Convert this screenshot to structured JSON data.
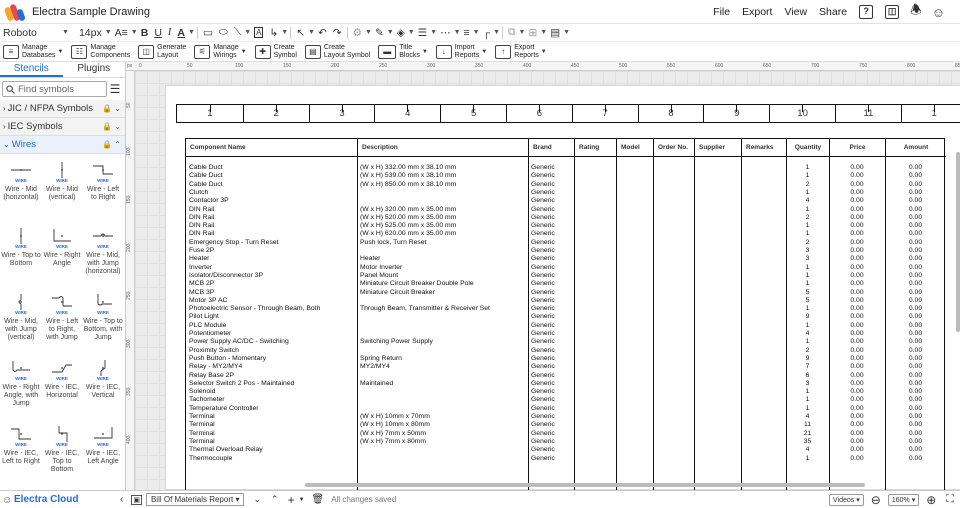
{
  "app": {
    "title": "Electra Sample Drawing"
  },
  "menu": [
    "File",
    "Export",
    "View",
    "Share"
  ],
  "menu_icons": [
    "help-icon",
    "layout-icon",
    "bell-icon",
    "user-icon"
  ],
  "format_toolbar": {
    "font": "Roboto",
    "size": "14px",
    "text_size_label": "A≡",
    "bold": "B",
    "underline": "U",
    "italic": "I",
    "font_color": "A"
  },
  "toolbar": [
    {
      "icon": "database-icon",
      "label1": "Manage",
      "label2": "Databases"
    },
    {
      "icon": "components-icon",
      "label1": "Manage",
      "label2": "Components"
    },
    {
      "icon": "generate-layout-icon",
      "label1": "Generate",
      "label2": "Layout"
    },
    {
      "icon": "wirings-icon",
      "label1": "Manage",
      "label2": "Wirings"
    },
    {
      "icon": "create-symbol-icon",
      "label1": "Create",
      "label2": "Symbol"
    },
    {
      "icon": "layout-symbol-icon",
      "label1": "Create",
      "label2": "Layout Symbol"
    },
    {
      "icon": "title-blocks-icon",
      "label1": "Title",
      "label2": "Blocks"
    },
    {
      "icon": "import-icon",
      "label1": "Import",
      "label2": "Reports"
    },
    {
      "icon": "export-icon",
      "label1": "Export",
      "label2": "Reports"
    }
  ],
  "sidebar": {
    "tabs": [
      "Stencils",
      "Plugins"
    ],
    "search_placeholder": "Find symbols",
    "categories": [
      "JIC / NFPA Symbols",
      "IEC Symbols",
      "Wires"
    ],
    "wire_label": "WIRE",
    "stencils": [
      "Wire - Mid (horizontal)",
      "Wire - Mid (vertical)",
      "Wire - Left to Right",
      "Wire - Top to Bottom",
      "Wire - Right Angle",
      "Wire - Mid, with Jump (horizontal)",
      "Wire - Mid, with Jump (vertical)",
      "Wire - Left to Right, with Jump",
      "Wire - Top to Bottom, with Jump",
      "Wire - Right Angle, with Jump",
      "Wire - IEC, Horizontal",
      "Wire - IEC, Vertical",
      "Wire - IEC, Left to Right",
      "Wire - IEC, Top to Bottom",
      "Wire - IEC, Left Angle"
    ]
  },
  "rulers": {
    "top": [
      "px",
      "0",
      "50",
      "100",
      "150",
      "200",
      "250",
      "300",
      "350",
      "400",
      "450",
      "500",
      "550",
      "600",
      "650",
      "700",
      "750",
      "800",
      "850"
    ],
    "left": [
      "50",
      "100",
      "150",
      "200",
      "250",
      "300",
      "350",
      "400"
    ]
  },
  "zones": [
    "1",
    "2",
    "3",
    "4",
    "5",
    "6",
    "7",
    "8",
    "9",
    "10",
    "11",
    "1"
  ],
  "bom": {
    "headers": [
      "Component Name",
      "Description",
      "Brand",
      "Rating",
      "Model",
      "Order No.",
      "Supplier",
      "Remarks",
      "Quantity",
      "Price",
      "Amount"
    ],
    "rows": [
      [
        "Cable Duct",
        "(W x H) 332.00 mm x 38.10 mm",
        "Generic",
        "1",
        "0.00",
        "0.00"
      ],
      [
        "Cable Duct",
        "(W x H) 539.00 mm x 38.10 mm",
        "Generic",
        "1",
        "0.00",
        "0.00"
      ],
      [
        "Cable Duct",
        "(W x H) 850.00 mm x 38.10 mm",
        "Generic",
        "2",
        "0.00",
        "0.00"
      ],
      [
        "Clutch",
        "",
        "Generic",
        "1",
        "0.00",
        "0.00"
      ],
      [
        "Contactor 3P",
        "",
        "Generic",
        "4",
        "0.00",
        "0.00"
      ],
      [
        "DIN Rail",
        "(W x H) 320.00 mm x 35.00 mm",
        "Generic",
        "1",
        "0.00",
        "0.00"
      ],
      [
        "DIN Rail",
        "(W x H) 520.00 mm x 35.00 mm",
        "Generic",
        "2",
        "0.00",
        "0.00"
      ],
      [
        "DIN Rail",
        "(W x H) 525.00 mm x 35.00 mm",
        "Generic",
        "1",
        "0.00",
        "0.00"
      ],
      [
        "DIN Rail",
        "(W x H) 620.00 mm x 35.00 mm",
        "Generic",
        "1",
        "0.00",
        "0.00"
      ],
      [
        "Emergency Stop - Turn Reset",
        "Push lock, Turn Reset",
        "Generic",
        "2",
        "0.00",
        "0.00"
      ],
      [
        "Fuse 2P",
        "",
        "Generic",
        "3",
        "0.00",
        "0.00"
      ],
      [
        "Heater",
        "Heater",
        "Generic",
        "3",
        "0.00",
        "0.00"
      ],
      [
        "Inverter",
        "Motor Inverter",
        "Generic",
        "1",
        "0.00",
        "0.00"
      ],
      [
        "Isolator/Disconnector 3P",
        "Panel Mount",
        "Generic",
        "1",
        "0.00",
        "0.00"
      ],
      [
        "MCB 2P",
        "Miniature Circuit Breaker Double Pole",
        "Generic",
        "1",
        "0.00",
        "0.00"
      ],
      [
        "MCB 3P",
        "Miniature Circuit Breaker",
        "Generic",
        "5",
        "0.00",
        "0.00"
      ],
      [
        "Motor 3P AC",
        "",
        "Generic",
        "5",
        "0.00",
        "0.00"
      ],
      [
        "Photoelectric Sensor - Through Beam, Both",
        "Through Beam, Transmitter & Receiver Set",
        "Generic",
        "1",
        "0.00",
        "0.00"
      ],
      [
        "Pilot Light",
        "",
        "Generic",
        "9",
        "0.00",
        "0.00"
      ],
      [
        "PLC Module",
        "",
        "Generic",
        "1",
        "0.00",
        "0.00"
      ],
      [
        "Potentiometer",
        "",
        "Generic",
        "4",
        "0.00",
        "0.00"
      ],
      [
        "Power Supply AC/DC - Switching",
        "Switching Power Supply",
        "Generic",
        "1",
        "0.00",
        "0.00"
      ],
      [
        "Proximity Switch",
        "",
        "Generic",
        "2",
        "0.00",
        "0.00"
      ],
      [
        "Push Button - Momentary",
        "Spring Return",
        "Generic",
        "9",
        "0.00",
        "0.00"
      ],
      [
        "Relay - MY2/MY4",
        "MY2/MY4",
        "Generic",
        "7",
        "0.00",
        "0.00"
      ],
      [
        "Relay Base 2P",
        "",
        "Generic",
        "6",
        "0.00",
        "0.00"
      ],
      [
        "Selector Switch 2 Pos - Maintained",
        "Maintained",
        "Generic",
        "3",
        "0.00",
        "0.00"
      ],
      [
        "Solenoid",
        "",
        "Generic",
        "1",
        "0.00",
        "0.00"
      ],
      [
        "Tachometer",
        "",
        "Generic",
        "1",
        "0.00",
        "0.00"
      ],
      [
        "Temperature Controller",
        "",
        "Generic",
        "1",
        "0.00",
        "0.00"
      ],
      [
        "Terminal",
        "(W x H) 10mm x 70mm",
        "Generic",
        "4",
        "0.00",
        "0.00"
      ],
      [
        "Terminal",
        "(W x H) 10mm x 80mm",
        "Generic",
        "11",
        "0.00",
        "0.00"
      ],
      [
        "Terminal",
        "(W x H) 7mm x 50mm",
        "Generic",
        "21",
        "0.00",
        "0.00"
      ],
      [
        "Terminal",
        "(W x H) 7mm x 80mm",
        "Generic",
        "35",
        "0.00",
        "0.00"
      ],
      [
        "Thermal Overload Relay",
        "",
        "Generic",
        "4",
        "0.00",
        "0.00"
      ],
      [
        "Thermocouple",
        "",
        "Generic",
        "1",
        "0.00",
        "0.00"
      ]
    ]
  },
  "status": {
    "brand": "Electra Cloud",
    "page_select": "Bill Of Materials Report",
    "save_state": "All changes saved",
    "videos": "Videos",
    "zoom": "160%"
  },
  "colors": {
    "accent": "#1e6fd9",
    "logo": [
      "#f5a623",
      "#e5484d",
      "#1e6fd9"
    ]
  }
}
